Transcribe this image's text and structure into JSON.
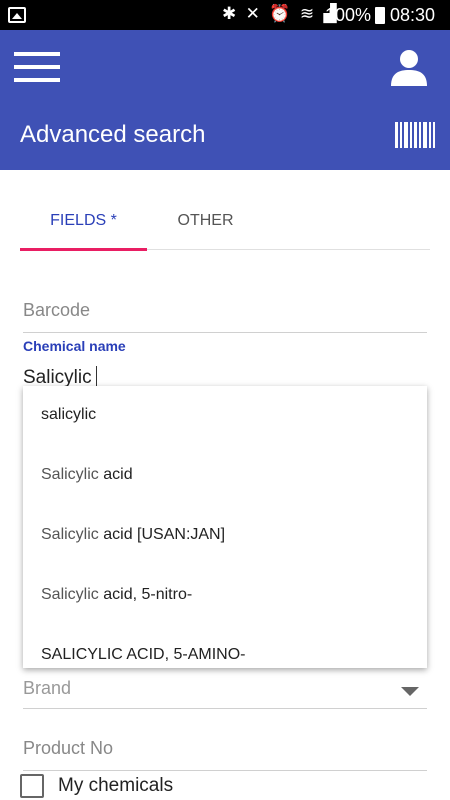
{
  "status_bar": {
    "battery": "100%",
    "time": "08:30",
    "icons": [
      "image-icon",
      "bluetooth-icon",
      "mute-icon",
      "alarm-icon",
      "wifi-icon",
      "signal-icon",
      "battery-icon"
    ]
  },
  "app_bar": {
    "title": "Advanced search",
    "background": "#3f51b5"
  },
  "tabs": [
    {
      "label": "FIELDS *",
      "active": true
    },
    {
      "label": "OTHER",
      "active": false
    }
  ],
  "form": {
    "barcode_placeholder": "Barcode",
    "chemical_name_label": "Chemical name",
    "chemical_name_value": "Salicylic",
    "brand_placeholder": "Brand",
    "product_no_placeholder": "Product No",
    "my_chemicals_label": "My chemicals",
    "my_chemicals_checked": false
  },
  "suggestions": [
    {
      "match": "",
      "rest": "salicylic"
    },
    {
      "match": "Salicylic",
      "rest": " acid"
    },
    {
      "match": "Salicylic",
      "rest": " acid [USAN:JAN]"
    },
    {
      "match": "Salicylic",
      "rest": " acid, 5-nitro-"
    },
    {
      "match": "",
      "rest": "SALICYLIC ACID, 5-AMINO-"
    }
  ],
  "colors": {
    "accent": "#e91e63",
    "primary": "#3f51b5",
    "label": "#2a3fb8"
  }
}
